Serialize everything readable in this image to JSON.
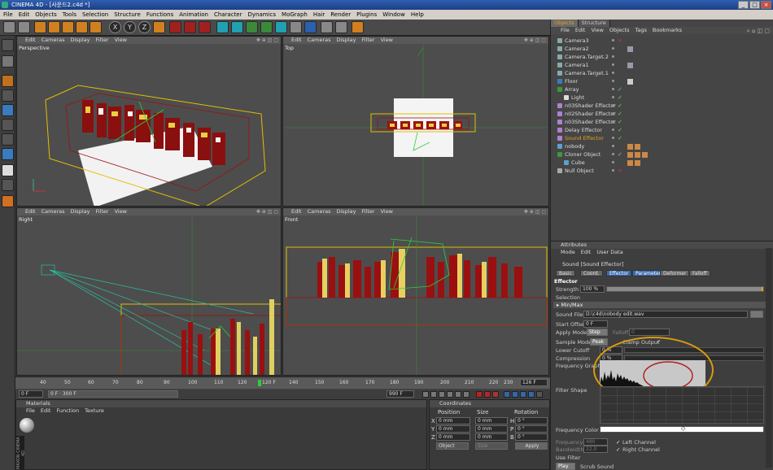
{
  "window": {
    "title": "CINEMA 4D - [사운드2.c4d *]"
  },
  "menu": [
    "File",
    "Edit",
    "Objects",
    "Tools",
    "Selection",
    "Structure",
    "Functions",
    "Animation",
    "Character",
    "Dynamics",
    "MoGraph",
    "Hair",
    "Render",
    "Plugins",
    "Window",
    "Help"
  ],
  "toolbar": {
    "axis_x": "X",
    "axis_y": "Y",
    "axis_z": "Z"
  },
  "viewports": [
    {
      "label": "Perspective",
      "menu": [
        "Edit",
        "Cameras",
        "Display",
        "Filter",
        "View"
      ]
    },
    {
      "label": "Top",
      "menu": [
        "Edit",
        "Cameras",
        "Display",
        "Filter",
        "View"
      ]
    },
    {
      "label": "Right",
      "menu": [
        "Edit",
        "Cameras",
        "Display",
        "Filter",
        "View"
      ]
    },
    {
      "label": "Front",
      "menu": [
        "Edit",
        "Cameras",
        "Display",
        "Filter",
        "View"
      ]
    }
  ],
  "timeline": {
    "ticks": [
      "40",
      "50",
      "60",
      "70",
      "80",
      "90",
      "100",
      "110",
      "120",
      "130",
      "140",
      "150",
      "160",
      "170",
      "180",
      "190",
      "200",
      "210",
      "220",
      "230",
      "240",
      "250"
    ],
    "marker": "120 F",
    "current_frame": "0 F",
    "start_field": "0 F",
    "end_field": "300 F",
    "end_frame": "990 F",
    "end_right": "126 F"
  },
  "materials": {
    "title": "Materials",
    "menu": [
      "File",
      "Edit",
      "Function",
      "Texture"
    ]
  },
  "coordinates": {
    "title": "Coordinates",
    "headers": [
      "Position",
      "Size",
      "Rotation"
    ],
    "rows": [
      {
        "axis": "X",
        "pos": "0 mm",
        "size": "0 mm",
        "rot_axis": "H",
        "rot": "0 °"
      },
      {
        "axis": "Y",
        "pos": "0 mm",
        "size": "0 mm",
        "rot_axis": "P",
        "rot": "0 °"
      },
      {
        "axis": "Z",
        "pos": "0 mm",
        "size": "0 mm",
        "rot_axis": "B",
        "rot": "0 °"
      }
    ],
    "mode_select": "Object",
    "size_select": "Size",
    "apply": "Apply"
  },
  "objects_panel": {
    "tabs": [
      "Objects",
      "Structure"
    ],
    "menu": [
      "File",
      "Edit",
      "View",
      "Objects",
      "Tags",
      "Bookmarks"
    ],
    "items": [
      {
        "name": "Camera3",
        "indent": 0
      },
      {
        "name": "Camera2",
        "indent": 0
      },
      {
        "name": "Camera.Target.2",
        "indent": 0
      },
      {
        "name": "Camera1",
        "indent": 0
      },
      {
        "name": "Camera.Target.1",
        "indent": 0
      },
      {
        "name": "Floor",
        "indent": 0
      },
      {
        "name": "Array",
        "indent": 0
      },
      {
        "name": "Light",
        "indent": 1
      },
      {
        "name": "n03Shader Effector",
        "indent": 0
      },
      {
        "name": "n02Shader Effector",
        "indent": 0
      },
      {
        "name": "n03Shader Effector",
        "indent": 0
      },
      {
        "name": "Delay Effector",
        "indent": 0
      },
      {
        "name": "Sound Effector",
        "indent": 0,
        "selected": true
      },
      {
        "name": "nobody",
        "indent": 0
      },
      {
        "name": "Cloner Object",
        "indent": 0
      },
      {
        "name": "Cube",
        "indent": 1
      },
      {
        "name": "Null Object",
        "indent": 0
      }
    ]
  },
  "attributes": {
    "title": "Attributes",
    "menu": [
      "Mode",
      "Edit",
      "User Data"
    ],
    "object_title": "Sound [Sound Effector]",
    "tabs": [
      "Basic",
      "Coord.",
      "Effector",
      "Parameter",
      "Deformer",
      "Falloff"
    ],
    "section_effector": "Effector",
    "strength_label": "Strength",
    "strength_value": "100 %",
    "selection_label": "Selection",
    "minmax": "▸ Min/Max",
    "soundfile_label": "Sound File",
    "soundfile_value": "D:\\c4d\\nobody edit.wav",
    "start_offset_label": "Start Offset",
    "start_offset_value": "0 F",
    "apply_mode_label": "Apply Mode",
    "apply_mode_value": "Step",
    "falloff_label": "Falloff",
    "falloff_value": "0",
    "sample_mode_label": "Sample Mode",
    "sample_mode_value": "Peak",
    "clamp_label": "Clamp Output",
    "lower_cutoff_label": "Lower Cutoff",
    "lower_cutoff_value": "0 %",
    "compression_label": "Compression",
    "compression_value": "0 %",
    "freq_graph_label": "Frequency Graph",
    "filter_shape_label": "Filter Shape",
    "freq_color_label": "Frequency Color",
    "frequency_label": "Frequency",
    "frequency_value": "480",
    "bandwidth_label": "Bandwidth",
    "bandwidth_value": "22.0",
    "left_channel": "Left Channel",
    "right_channel": "Right Channel",
    "use_filter": "Use Filter",
    "play_btn": "Play",
    "scrub_label": "Scrub Sound"
  },
  "colors": {
    "accent": "#e6a020",
    "selected_tab": "#3a6ab0",
    "annotation": "#d89a10",
    "annotation_red": "#b01818"
  }
}
